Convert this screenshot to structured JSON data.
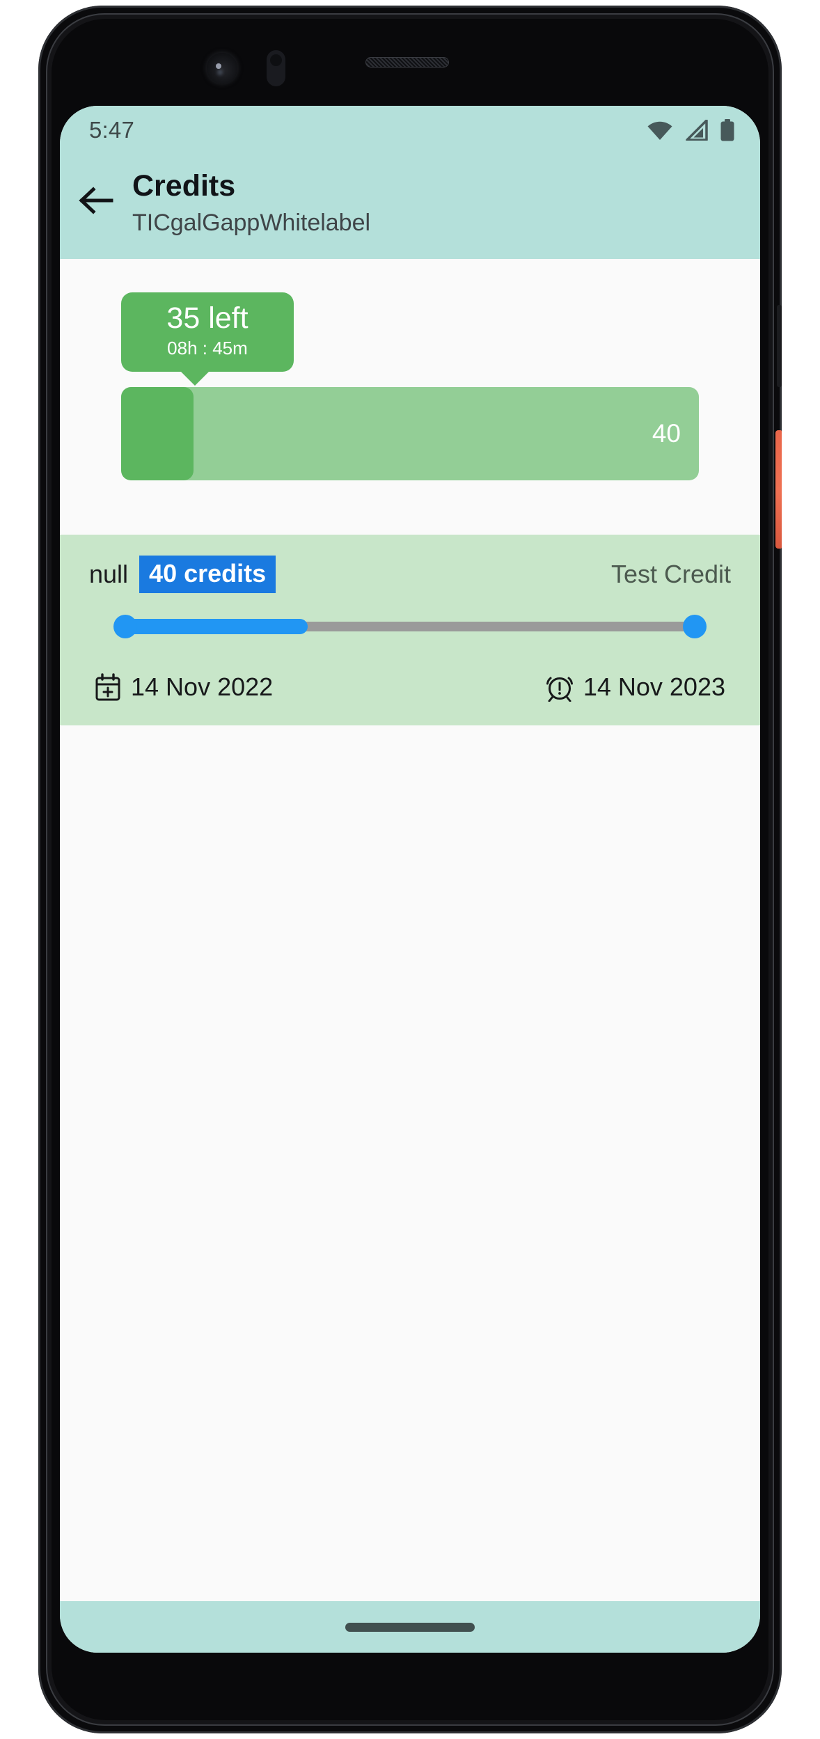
{
  "statusbar": {
    "time": "5:47",
    "icons": [
      "wifi-icon",
      "cellular-signal-icon",
      "battery-icon"
    ]
  },
  "appbar": {
    "back_icon": "arrow-left-icon",
    "title": "Credits",
    "subtitle": "TICgalGappWhitelabel"
  },
  "summary": {
    "badge": {
      "remaining": "35 left",
      "time_remaining": "08h : 45m"
    },
    "progress": {
      "total_label": "40",
      "used": 5,
      "total": 40,
      "remaining": 35,
      "fill_percent": 12.5
    }
  },
  "credit_card": {
    "owner": "null",
    "credits_chip": "40 credits",
    "name": "Test Credit",
    "slider": {
      "low_percent": 0,
      "high_percent": 100,
      "fill_percent": 32
    },
    "start": {
      "icon": "calendar-plus-icon",
      "date": "14 Nov 2022"
    },
    "end": {
      "icon": "alarm-clock-icon",
      "date": "14 Nov 2023"
    }
  },
  "navbar": {
    "gesture_pill": "gesture-home-pill"
  },
  "colors": {
    "appbar_teal": "#b4e0da",
    "badge_green": "#5cb65f",
    "progress_track_green": "#93ce96",
    "card_green": "#c8e6c9",
    "slider_blue": "#2196f3",
    "chip_blue": "#1a7ae0",
    "screen_background": "#fafafa"
  }
}
